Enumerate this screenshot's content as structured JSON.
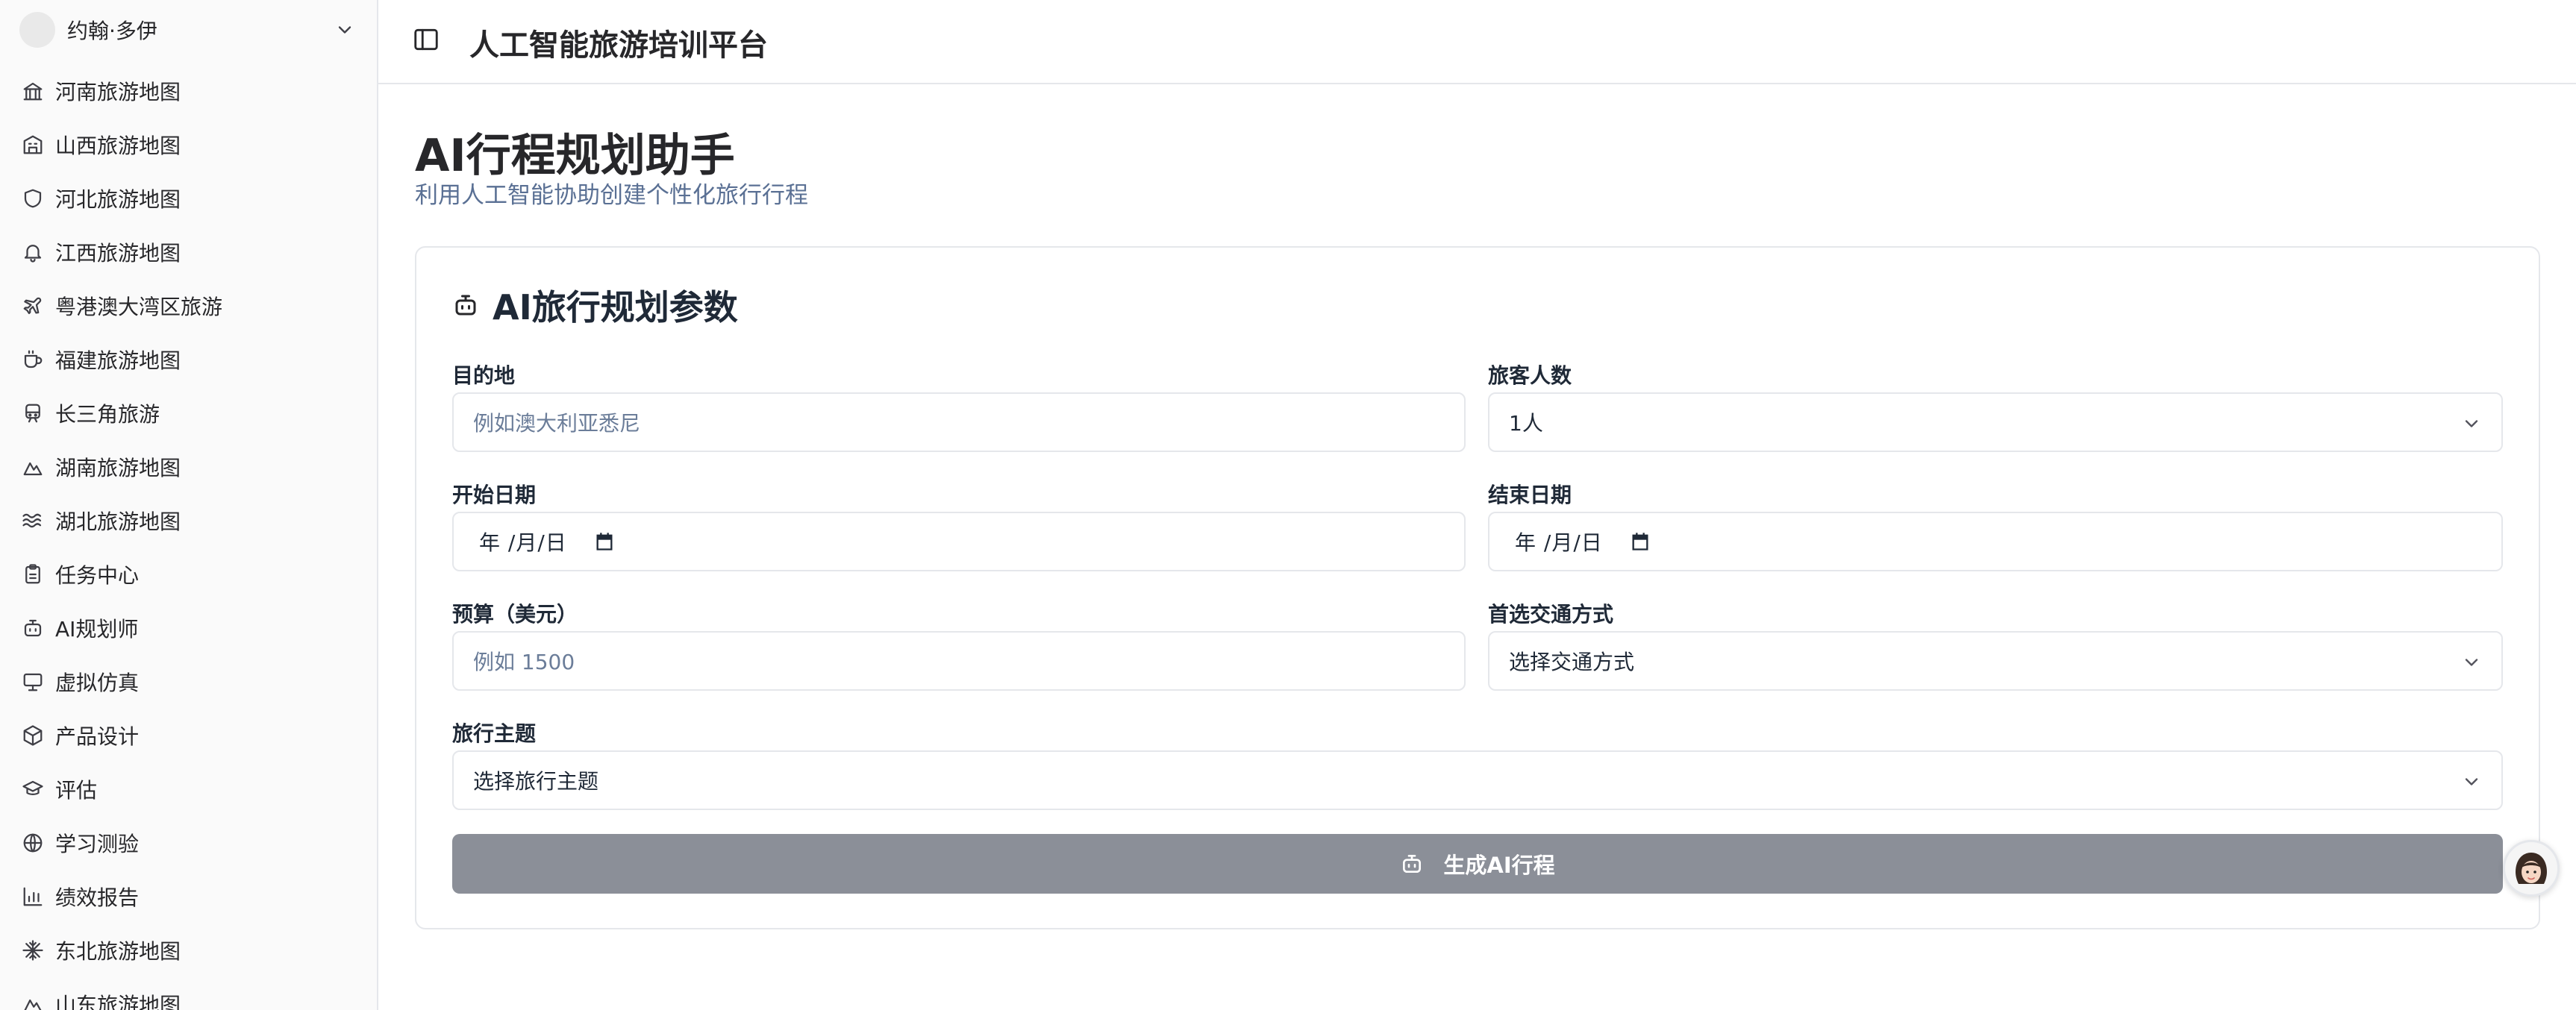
{
  "user": {
    "name": "约翰·多伊"
  },
  "sidebar": {
    "items": [
      {
        "label": "河南旅游地图",
        "icon": "landmark-icon"
      },
      {
        "label": "山西旅游地图",
        "icon": "building-icon"
      },
      {
        "label": "河北旅游地图",
        "icon": "shield-icon"
      },
      {
        "label": "江西旅游地图",
        "icon": "bell-icon"
      },
      {
        "label": "粤港澳大湾区旅游",
        "icon": "plane-icon"
      },
      {
        "label": "福建旅游地图",
        "icon": "tea-cup-icon"
      },
      {
        "label": "长三角旅游",
        "icon": "train-icon"
      },
      {
        "label": "湖南旅游地图",
        "icon": "mountain-icon"
      },
      {
        "label": "湖北旅游地图",
        "icon": "waves-icon"
      },
      {
        "label": "任务中心",
        "icon": "clipboard-icon"
      },
      {
        "label": "AI规划师",
        "icon": "bot-icon"
      },
      {
        "label": "虚拟仿真",
        "icon": "monitor-icon"
      },
      {
        "label": "产品设计",
        "icon": "box-icon"
      },
      {
        "label": "评估",
        "icon": "graduation-cap-icon"
      },
      {
        "label": "学习测验",
        "icon": "globe-icon"
      },
      {
        "label": "绩效报告",
        "icon": "bar-chart-icon"
      },
      {
        "label": "东北旅游地图",
        "icon": "snowflake-icon"
      },
      {
        "label": "山东旅游地图",
        "icon": "mountain-icon"
      }
    ]
  },
  "header": {
    "title": "人工智能旅游培训平台"
  },
  "page": {
    "title": "AI行程规划助手",
    "subtitle": "利用人工智能协助创建个性化旅行行程"
  },
  "form": {
    "title": "AI旅行规划参数",
    "destination": {
      "label": "目的地",
      "placeholder": "例如澳大利亚悉尼"
    },
    "travelers": {
      "label": "旅客人数",
      "value": "1人"
    },
    "start_date": {
      "label": "开始日期",
      "value": "年 /月/日"
    },
    "end_date": {
      "label": "结束日期",
      "value": "年 /月/日"
    },
    "budget": {
      "label": "预算（美元）",
      "placeholder": "例如 1500"
    },
    "transport": {
      "label": "首选交通方式",
      "value": "选择交通方式"
    },
    "theme": {
      "label": "旅行主题",
      "value": "选择旅行主题"
    },
    "submit_label": "生成AI行程"
  },
  "colors": {
    "button_disabled": "#8b8f98",
    "subtitle": "#5a7094",
    "border": "#e5e7eb"
  }
}
